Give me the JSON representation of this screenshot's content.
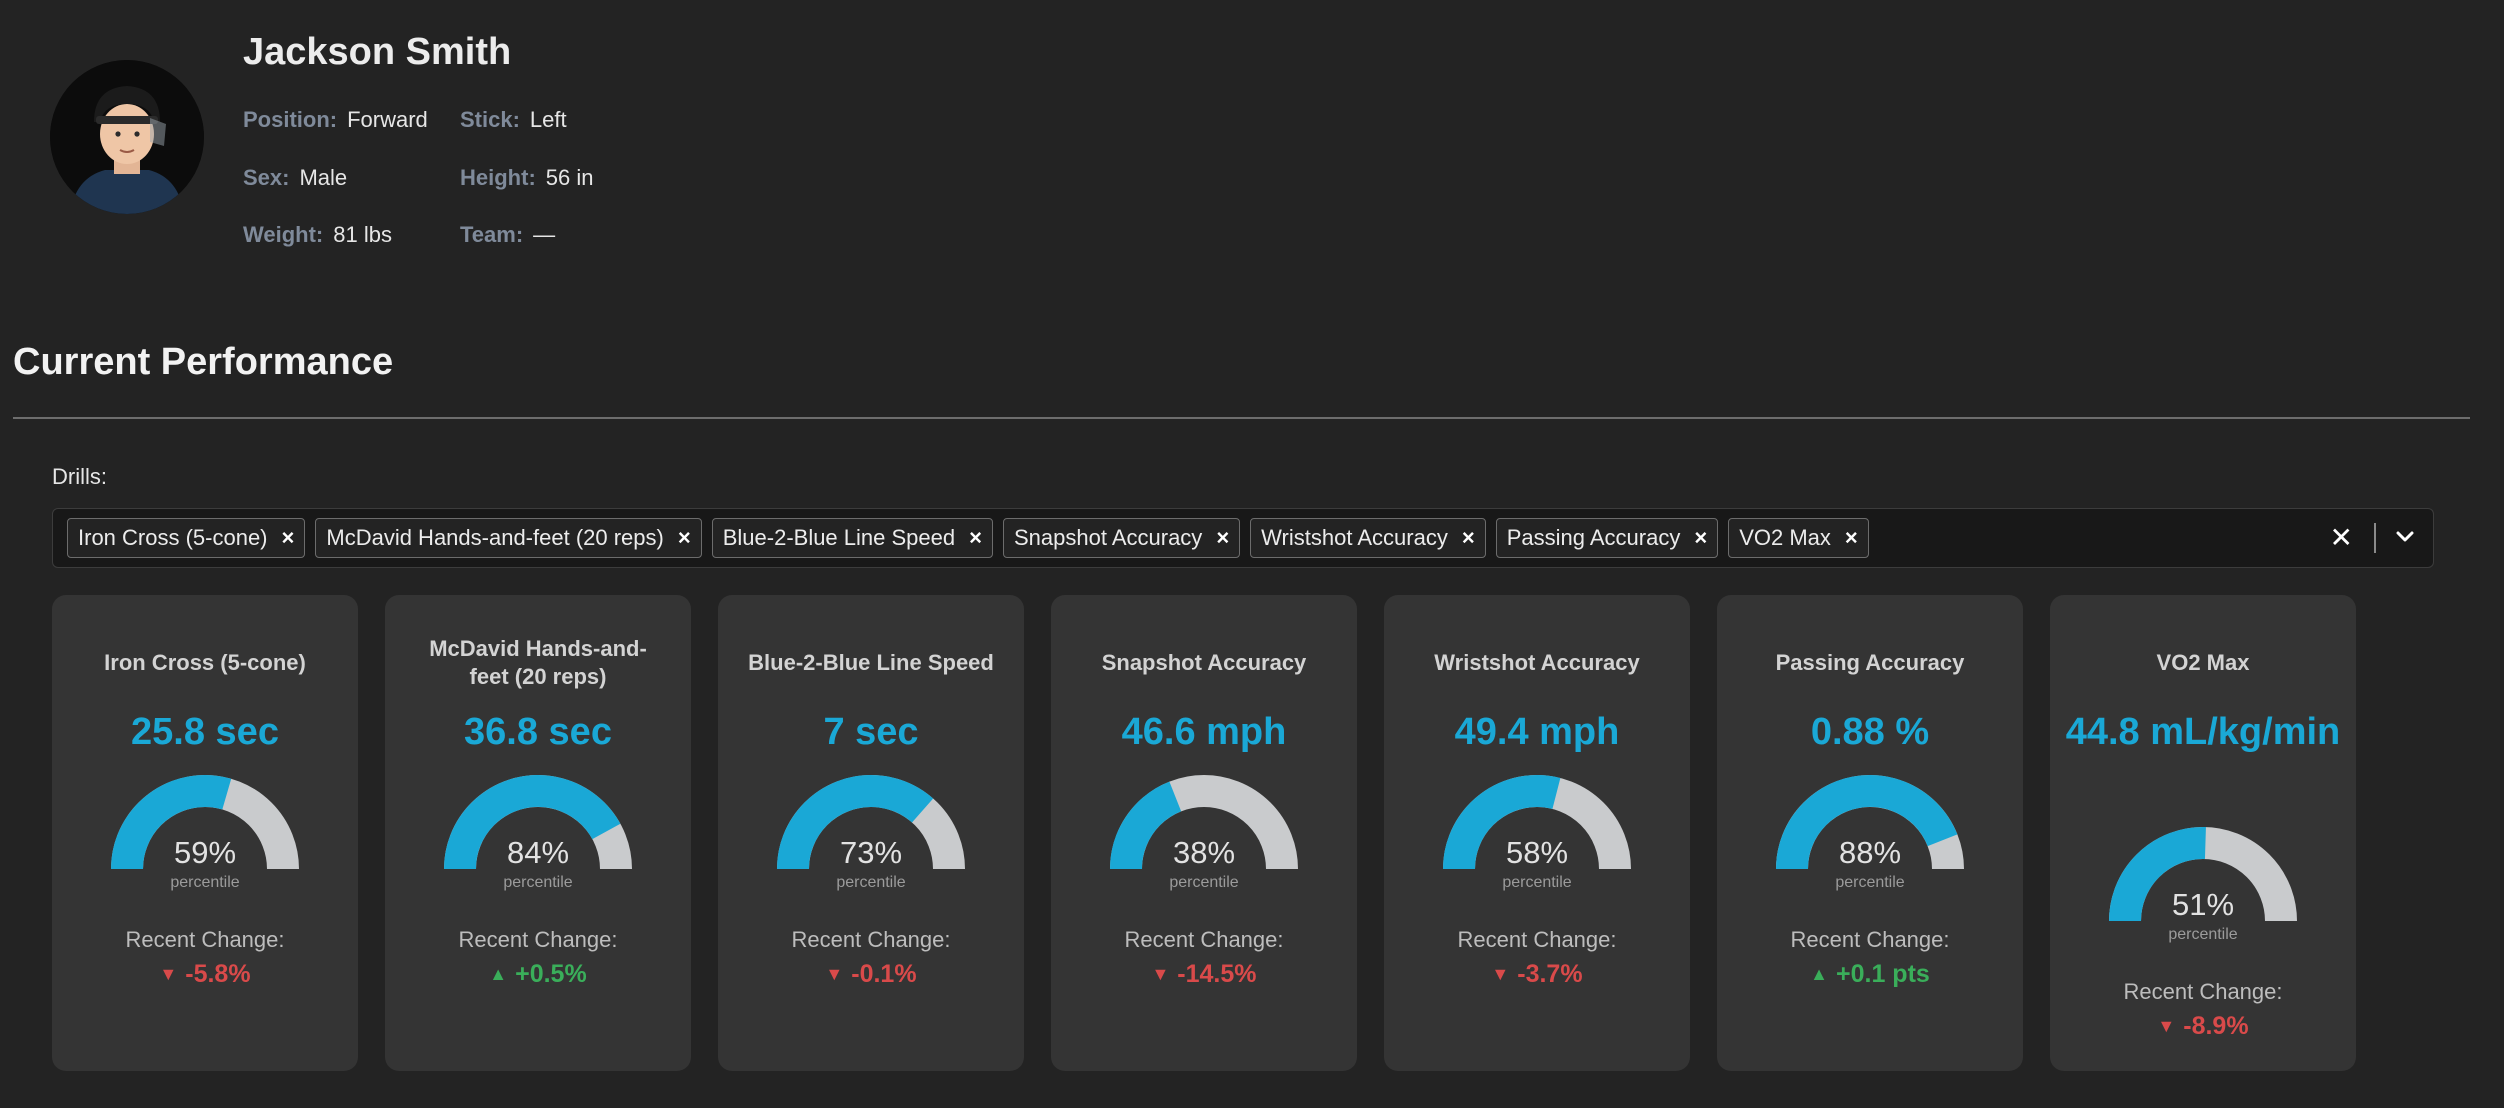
{
  "player": {
    "name": "Jackson Smith",
    "fields": {
      "position": {
        "label": "Position:",
        "value": "Forward"
      },
      "stick": {
        "label": "Stick:",
        "value": "Left"
      },
      "sex": {
        "label": "Sex:",
        "value": "Male"
      },
      "height": {
        "label": "Height:",
        "value": "56 in"
      },
      "weight": {
        "label": "Weight:",
        "value": "81 lbs"
      },
      "team": {
        "label": "Team:",
        "value": "—"
      }
    }
  },
  "section": {
    "title": "Current Performance"
  },
  "drills": {
    "label": "Drills:",
    "selected": [
      "Iron Cross (5-cone)",
      "McDavid Hands-and-feet (20 reps)",
      "Blue-2-Blue Line Speed",
      "Snapshot Accuracy",
      "Wristshot Accuracy",
      "Passing Accuracy",
      "VO2 Max"
    ],
    "remove_glyph": "×",
    "clear_glyph": "✕"
  },
  "cards": [
    {
      "title": "Iron Cross (5-cone)",
      "value": "25.8 sec",
      "percentile": 59,
      "percentile_text": "59%",
      "percentile_label": "percentile",
      "change_label": "Recent Change:",
      "change": "-5.8%",
      "direction": "down"
    },
    {
      "title": "McDavid Hands-and-feet (20 reps)",
      "value": "36.8 sec",
      "percentile": 84,
      "percentile_text": "84%",
      "percentile_label": "percentile",
      "change_label": "Recent Change:",
      "change": "+0.5%",
      "direction": "up"
    },
    {
      "title": "Blue-2-Blue Line Speed",
      "value": "7 sec",
      "percentile": 73,
      "percentile_text": "73%",
      "percentile_label": "percentile",
      "change_label": "Recent Change:",
      "change": "-0.1%",
      "direction": "down"
    },
    {
      "title": "Snapshot Accuracy",
      "value": "46.6 mph",
      "percentile": 38,
      "percentile_text": "38%",
      "percentile_label": "percentile",
      "change_label": "Recent Change:",
      "change": "-14.5%",
      "direction": "down"
    },
    {
      "title": "Wristshot Accuracy",
      "value": "49.4 mph",
      "percentile": 58,
      "percentile_text": "58%",
      "percentile_label": "percentile",
      "change_label": "Recent Change:",
      "change": "-3.7%",
      "direction": "down"
    },
    {
      "title": "Passing Accuracy",
      "value": "0.88 %",
      "percentile": 88,
      "percentile_text": "88%",
      "percentile_label": "percentile",
      "change_label": "Recent Change:",
      "change": "+0.1 pts",
      "direction": "up"
    },
    {
      "title": "VO2 Max",
      "value": "44.8 mL/kg/min",
      "percentile": 51,
      "percentile_text": "51%",
      "percentile_label": "percentile",
      "change_label": "Recent Change:",
      "change": "-8.9%",
      "direction": "down"
    }
  ],
  "colors": {
    "accent": "#1aa8d6",
    "gauge_track": "#c9cbcd",
    "up": "#3aae5a",
    "down": "#d94a4a"
  },
  "icons": {
    "up": "▲",
    "down": "▼"
  }
}
